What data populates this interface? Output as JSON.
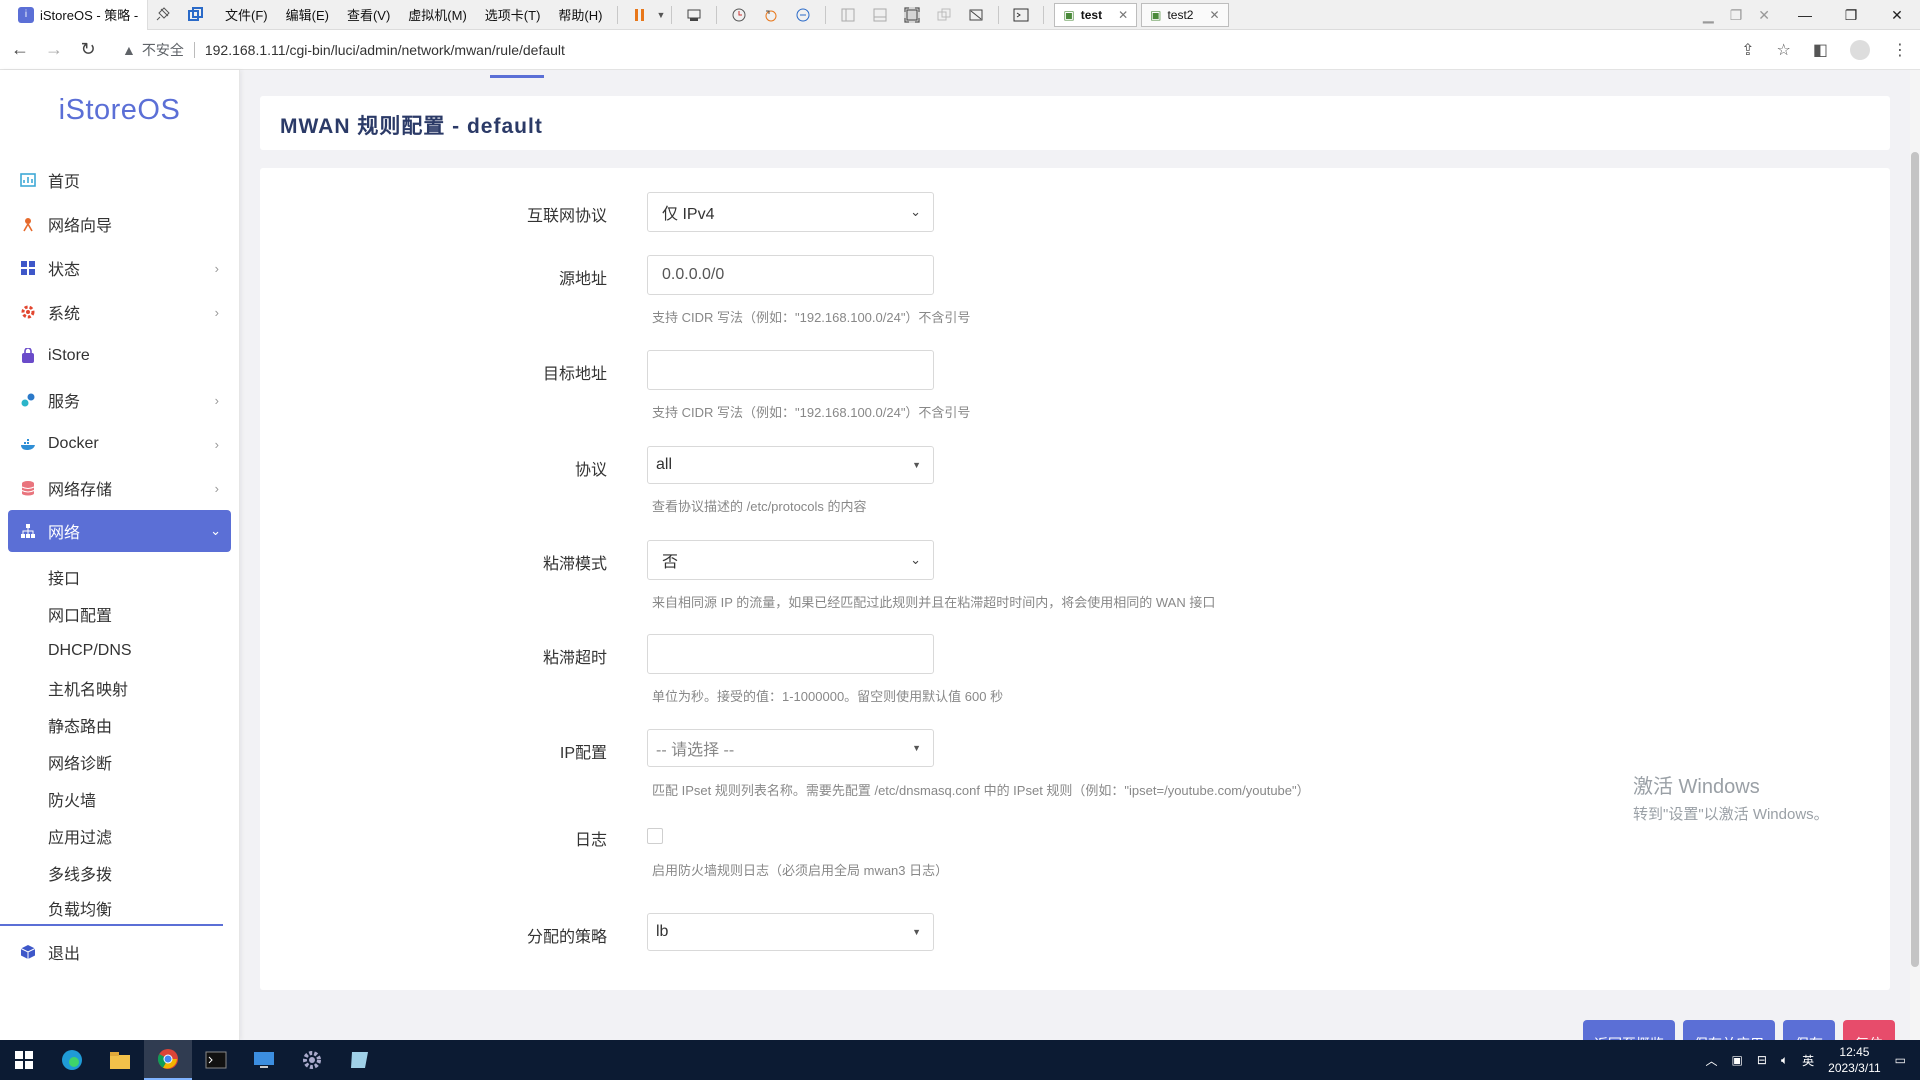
{
  "vmware": {
    "title_tab": "iStoreOS - 策略 -",
    "menu": [
      "文件(F)",
      "编辑(E)",
      "查看(V)",
      "虚拟机(M)",
      "选项卡(T)",
      "帮助(H)"
    ],
    "tabs": [
      "test",
      "test2"
    ]
  },
  "browser": {
    "insecure_label": "不安全",
    "url": "192.168.1.11/cgi-bin/luci/admin/network/mwan/rule/default"
  },
  "sidebar": {
    "brand": "iStoreOS",
    "items": [
      {
        "label": "首页"
      },
      {
        "label": "网络向导"
      },
      {
        "label": "状态"
      },
      {
        "label": "系统"
      },
      {
        "label": "iStore"
      },
      {
        "label": "服务"
      },
      {
        "label": "Docker"
      },
      {
        "label": "网络存储"
      },
      {
        "label": "网络"
      },
      {
        "label": "退出"
      }
    ],
    "sub_items": [
      "接口",
      "网口配置",
      "DHCP/DNS",
      "主机名映射",
      "静态路由",
      "网络诊断",
      "防火墙",
      "应用过滤",
      "多线多拨",
      "负载均衡"
    ]
  },
  "page": {
    "title": "MWAN 规则配置 - default"
  },
  "form": {
    "family": {
      "label": "互联网协议",
      "value": "仅 IPv4"
    },
    "src_ip": {
      "label": "源地址",
      "value": "0.0.0.0/0",
      "hint": "支持 CIDR 写法（例如：\"192.168.100.0/24\"）不含引号"
    },
    "dest_ip": {
      "label": "目标地址",
      "value": "",
      "hint": "支持 CIDR 写法（例如：\"192.168.100.0/24\"）不含引号"
    },
    "proto": {
      "label": "协议",
      "value": "all",
      "hint": "查看协议描述的 /etc/protocols 的内容"
    },
    "sticky": {
      "label": "粘滞模式",
      "value": "否",
      "hint": "来自相同源 IP 的流量，如果已经匹配过此规则并且在粘滞超时时间内，将会使用相同的 WAN 接口"
    },
    "timeout": {
      "label": "粘滞超时",
      "value": "",
      "hint": "单位为秒。接受的值：1-1000000。留空则使用默认值 600 秒"
    },
    "ipset": {
      "label": "IP配置",
      "value": "-- 请选择 --",
      "hint": "匹配 IPset 规则列表名称。需要先配置 /etc/dnsmasq.conf 中的 IPset 规则（例如：\"ipset=/youtube.com/youtube\"）"
    },
    "logging": {
      "label": "日志",
      "checked": false,
      "hint": "启用防火墙规则日志（必须启用全局 mwan3 日志）"
    },
    "use_policy": {
      "label": "分配的策略",
      "value": "lb"
    }
  },
  "actions": {
    "back": "返回至概览",
    "save_apply": "保存并应用",
    "save": "保存",
    "reset": "复位"
  },
  "watermark": {
    "line1": "激活 Windows",
    "line2": "转到\"设置\"以激活 Windows。"
  },
  "taskbar": {
    "time": "12:45",
    "date": "2023/3/11",
    "ime": "英"
  },
  "colors": {
    "accent": "#5b6fd6",
    "danger": "#e74c6b",
    "taskbar": "#0c1b33"
  }
}
